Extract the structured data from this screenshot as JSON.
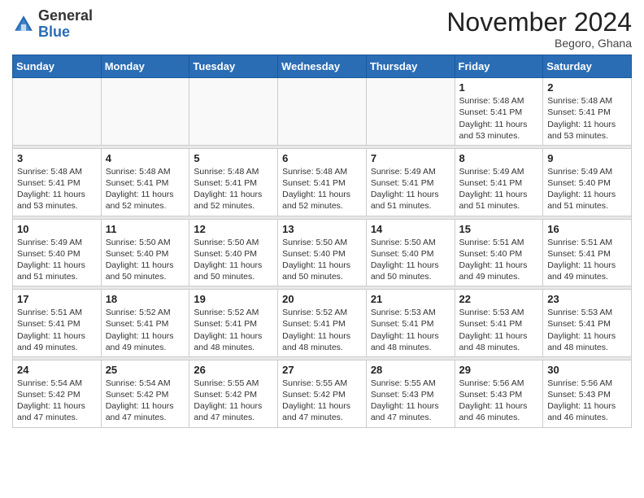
{
  "header": {
    "logo_general": "General",
    "logo_blue": "Blue",
    "month_title": "November 2024",
    "location": "Begoro, Ghana"
  },
  "weekdays": [
    "Sunday",
    "Monday",
    "Tuesday",
    "Wednesday",
    "Thursday",
    "Friday",
    "Saturday"
  ],
  "weeks": [
    [
      {
        "day": "",
        "info": ""
      },
      {
        "day": "",
        "info": ""
      },
      {
        "day": "",
        "info": ""
      },
      {
        "day": "",
        "info": ""
      },
      {
        "day": "",
        "info": ""
      },
      {
        "day": "1",
        "info": "Sunrise: 5:48 AM\nSunset: 5:41 PM\nDaylight: 11 hours\nand 53 minutes."
      },
      {
        "day": "2",
        "info": "Sunrise: 5:48 AM\nSunset: 5:41 PM\nDaylight: 11 hours\nand 53 minutes."
      }
    ],
    [
      {
        "day": "3",
        "info": "Sunrise: 5:48 AM\nSunset: 5:41 PM\nDaylight: 11 hours\nand 53 minutes."
      },
      {
        "day": "4",
        "info": "Sunrise: 5:48 AM\nSunset: 5:41 PM\nDaylight: 11 hours\nand 52 minutes."
      },
      {
        "day": "5",
        "info": "Sunrise: 5:48 AM\nSunset: 5:41 PM\nDaylight: 11 hours\nand 52 minutes."
      },
      {
        "day": "6",
        "info": "Sunrise: 5:48 AM\nSunset: 5:41 PM\nDaylight: 11 hours\nand 52 minutes."
      },
      {
        "day": "7",
        "info": "Sunrise: 5:49 AM\nSunset: 5:41 PM\nDaylight: 11 hours\nand 51 minutes."
      },
      {
        "day": "8",
        "info": "Sunrise: 5:49 AM\nSunset: 5:41 PM\nDaylight: 11 hours\nand 51 minutes."
      },
      {
        "day": "9",
        "info": "Sunrise: 5:49 AM\nSunset: 5:40 PM\nDaylight: 11 hours\nand 51 minutes."
      }
    ],
    [
      {
        "day": "10",
        "info": "Sunrise: 5:49 AM\nSunset: 5:40 PM\nDaylight: 11 hours\nand 51 minutes."
      },
      {
        "day": "11",
        "info": "Sunrise: 5:50 AM\nSunset: 5:40 PM\nDaylight: 11 hours\nand 50 minutes."
      },
      {
        "day": "12",
        "info": "Sunrise: 5:50 AM\nSunset: 5:40 PM\nDaylight: 11 hours\nand 50 minutes."
      },
      {
        "day": "13",
        "info": "Sunrise: 5:50 AM\nSunset: 5:40 PM\nDaylight: 11 hours\nand 50 minutes."
      },
      {
        "day": "14",
        "info": "Sunrise: 5:50 AM\nSunset: 5:40 PM\nDaylight: 11 hours\nand 50 minutes."
      },
      {
        "day": "15",
        "info": "Sunrise: 5:51 AM\nSunset: 5:40 PM\nDaylight: 11 hours\nand 49 minutes."
      },
      {
        "day": "16",
        "info": "Sunrise: 5:51 AM\nSunset: 5:41 PM\nDaylight: 11 hours\nand 49 minutes."
      }
    ],
    [
      {
        "day": "17",
        "info": "Sunrise: 5:51 AM\nSunset: 5:41 PM\nDaylight: 11 hours\nand 49 minutes."
      },
      {
        "day": "18",
        "info": "Sunrise: 5:52 AM\nSunset: 5:41 PM\nDaylight: 11 hours\nand 49 minutes."
      },
      {
        "day": "19",
        "info": "Sunrise: 5:52 AM\nSunset: 5:41 PM\nDaylight: 11 hours\nand 48 minutes."
      },
      {
        "day": "20",
        "info": "Sunrise: 5:52 AM\nSunset: 5:41 PM\nDaylight: 11 hours\nand 48 minutes."
      },
      {
        "day": "21",
        "info": "Sunrise: 5:53 AM\nSunset: 5:41 PM\nDaylight: 11 hours\nand 48 minutes."
      },
      {
        "day": "22",
        "info": "Sunrise: 5:53 AM\nSunset: 5:41 PM\nDaylight: 11 hours\nand 48 minutes."
      },
      {
        "day": "23",
        "info": "Sunrise: 5:53 AM\nSunset: 5:41 PM\nDaylight: 11 hours\nand 48 minutes."
      }
    ],
    [
      {
        "day": "24",
        "info": "Sunrise: 5:54 AM\nSunset: 5:42 PM\nDaylight: 11 hours\nand 47 minutes."
      },
      {
        "day": "25",
        "info": "Sunrise: 5:54 AM\nSunset: 5:42 PM\nDaylight: 11 hours\nand 47 minutes."
      },
      {
        "day": "26",
        "info": "Sunrise: 5:55 AM\nSunset: 5:42 PM\nDaylight: 11 hours\nand 47 minutes."
      },
      {
        "day": "27",
        "info": "Sunrise: 5:55 AM\nSunset: 5:42 PM\nDaylight: 11 hours\nand 47 minutes."
      },
      {
        "day": "28",
        "info": "Sunrise: 5:55 AM\nSunset: 5:43 PM\nDaylight: 11 hours\nand 47 minutes."
      },
      {
        "day": "29",
        "info": "Sunrise: 5:56 AM\nSunset: 5:43 PM\nDaylight: 11 hours\nand 46 minutes."
      },
      {
        "day": "30",
        "info": "Sunrise: 5:56 AM\nSunset: 5:43 PM\nDaylight: 11 hours\nand 46 minutes."
      }
    ]
  ]
}
